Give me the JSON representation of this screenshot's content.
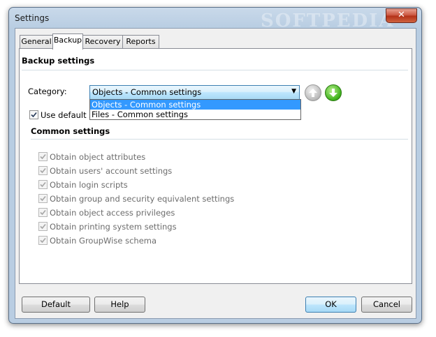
{
  "window": {
    "title": "Settings",
    "watermark": "SOFTPEDIA",
    "close_glyph": "✕"
  },
  "tabs": [
    {
      "label": "General"
    },
    {
      "label": "Backup"
    },
    {
      "label": "Recovery"
    },
    {
      "label": "Reports"
    }
  ],
  "backup": {
    "section_title": "Backup settings",
    "category_label": "Category:",
    "category_selected": "Objects - Common settings",
    "category_options": [
      "Objects - Common settings",
      "Files - Common settings"
    ],
    "use_default_label": "Use default se",
    "use_default_checked": true,
    "common_title": "Common settings",
    "options": [
      {
        "label": "Obtain object attributes",
        "checked": true
      },
      {
        "label": "Obtain users' account settings",
        "checked": true
      },
      {
        "label": "Obtain login scripts",
        "checked": true
      },
      {
        "label": "Obtain group and security equivalent settings",
        "checked": true
      },
      {
        "label": "Obtain object access privileges",
        "checked": true
      },
      {
        "label": "Obtain printing system settings",
        "checked": true
      },
      {
        "label": "Obtain GroupWise schema",
        "checked": true
      }
    ]
  },
  "buttons": {
    "default": "Default",
    "help": "Help",
    "ok": "OK",
    "cancel": "Cancel"
  },
  "icons": {
    "move_up": "arrow-up-icon",
    "move_down": "arrow-down-icon",
    "dropdown": "chevron-down-icon"
  },
  "colors": {
    "selection": "#3399ff",
    "accent_border": "#3c7fb1"
  }
}
